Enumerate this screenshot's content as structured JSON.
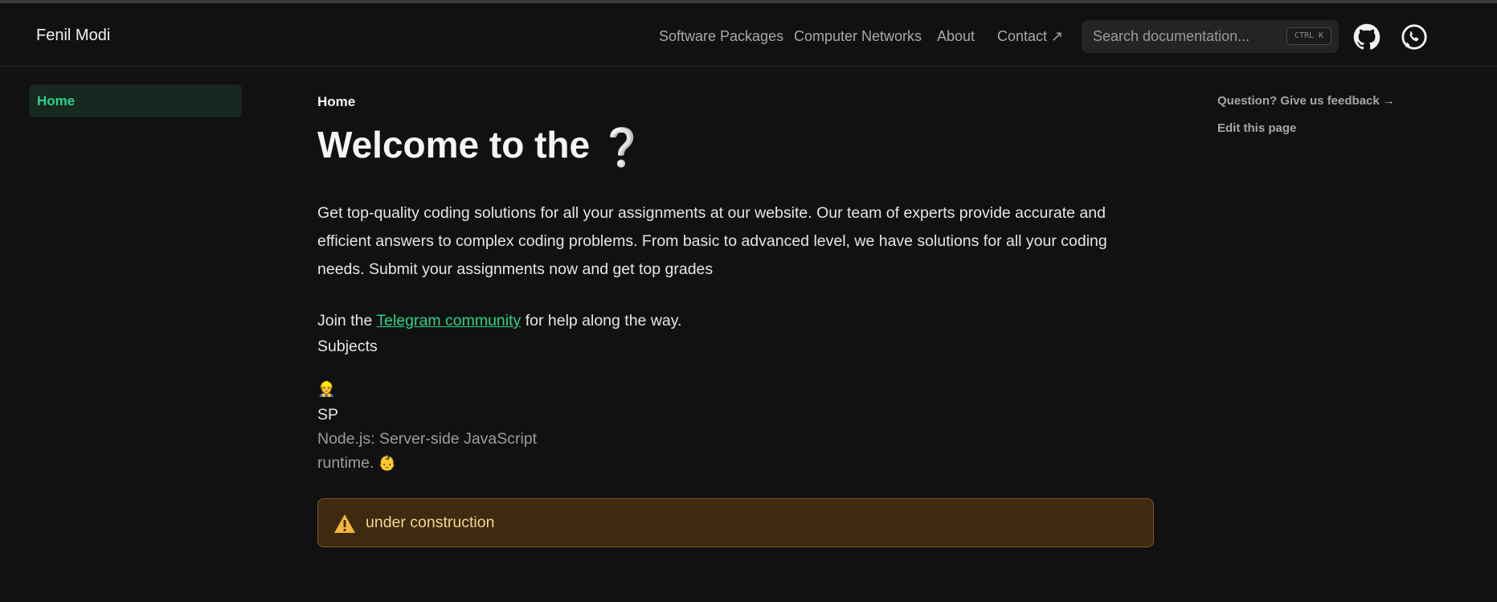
{
  "navbar": {
    "brand": "Fenil Modi",
    "links": [
      {
        "label": "Software Packages"
      },
      {
        "label": "Computer Networks"
      },
      {
        "label": "About"
      },
      {
        "label": "Contact ↗"
      }
    ],
    "search": {
      "placeholder": "Search documentation...",
      "shortcut": "CTRL K"
    },
    "icons": [
      "github-icon",
      "whatsapp-icon"
    ]
  },
  "sidebar": {
    "items": [
      {
        "label": "Home",
        "active": true
      }
    ]
  },
  "main": {
    "breadcrumb": "Home",
    "title": "Welcome to the",
    "title_glyph": "❔",
    "intro": "Get top-quality coding solutions for all your assignments at our website. Our team of experts provide accurate and efficient answers to complex coding problems. From basic to advanced level, we have solutions for all your coding needs. Submit your assignments now and get top grades",
    "join_prefix": "Join the",
    "join_link": "Telegram community",
    "join_suffix": "for help along the way.",
    "subjects_heading": "Subjects",
    "card": {
      "emoji": "👷",
      "code": "SP",
      "desc_line1": "Node.js: Server-side JavaScript",
      "desc_line2": "runtime.",
      "desc_emoji": "👶"
    },
    "callout": {
      "text": "under construction",
      "icon": "warning-icon"
    }
  },
  "toc": {
    "feedback": "Question? Give us feedback →",
    "edit": "Edit this page"
  },
  "colors": {
    "background": "#111111",
    "accent": "#2ad48a",
    "callout_bg": "#3e2a11",
    "callout_text": "#f6d58a"
  }
}
